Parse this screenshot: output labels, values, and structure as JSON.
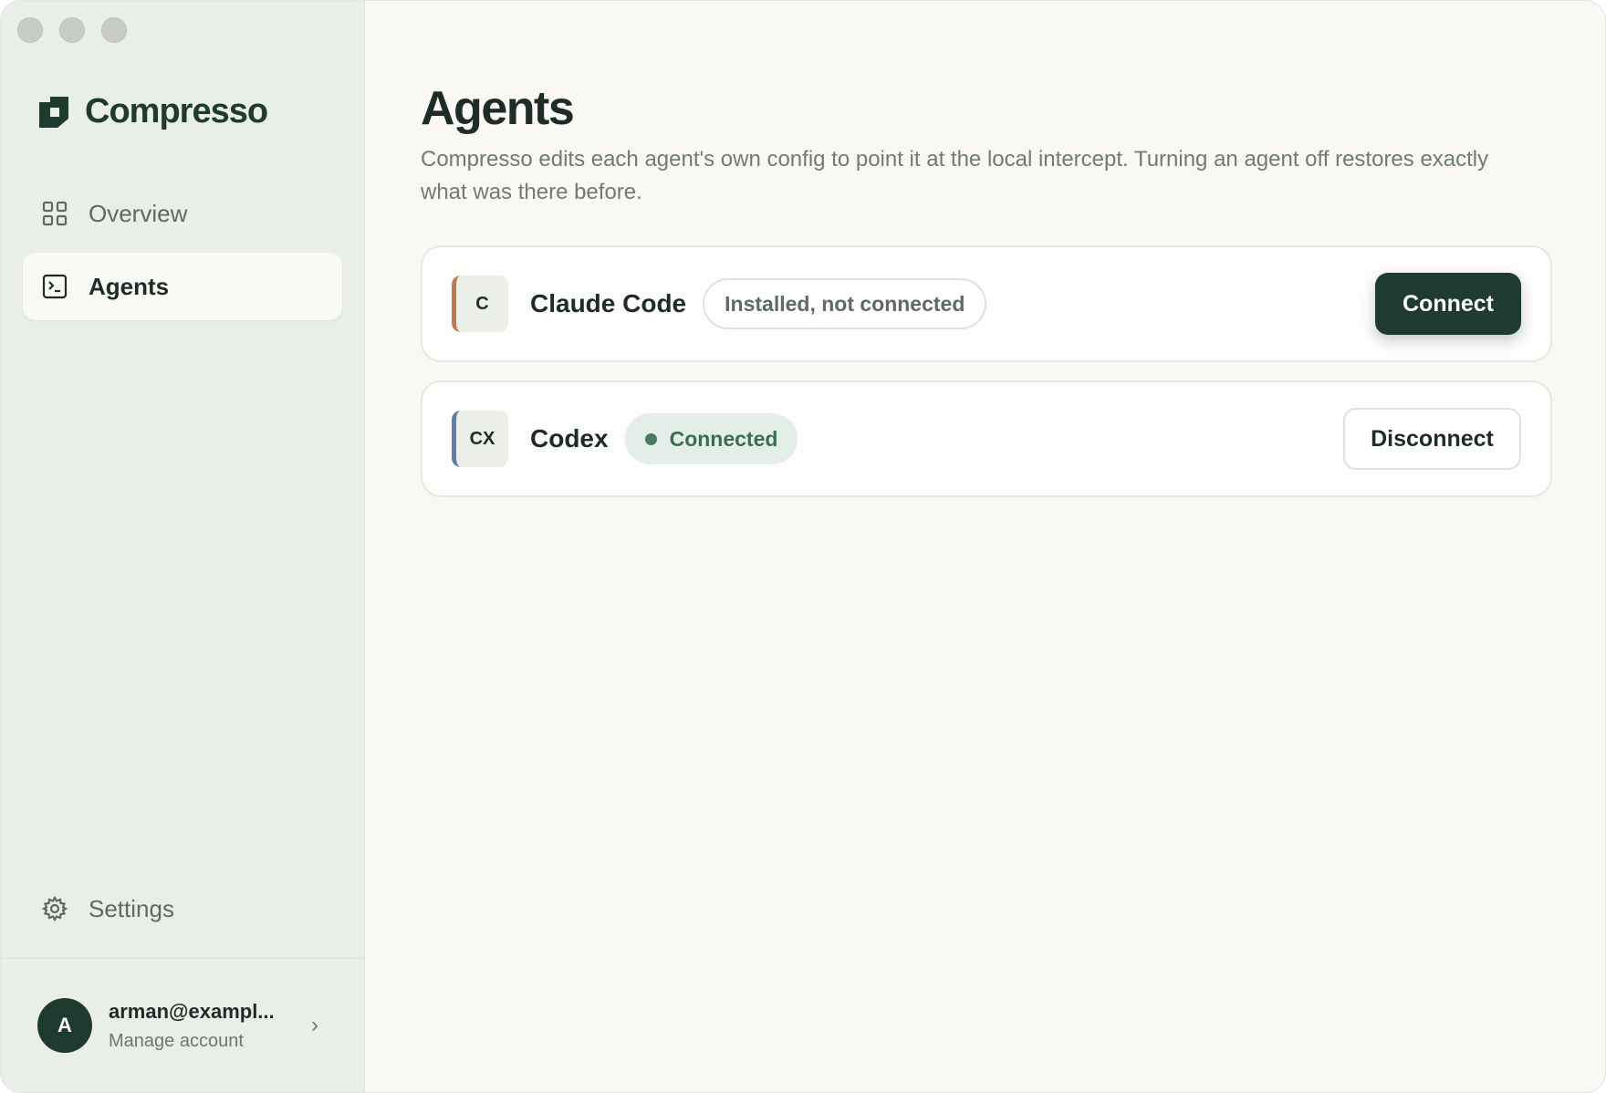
{
  "app": {
    "name": "Compresso"
  },
  "sidebar": {
    "items": [
      {
        "label": "Overview",
        "icon": "grid-icon",
        "active": false
      },
      {
        "label": "Agents",
        "icon": "terminal-icon",
        "active": true
      }
    ],
    "settings_label": "Settings",
    "account": {
      "avatar_letter": "A",
      "email": "arman@exampl...",
      "sub": "Manage account"
    }
  },
  "main": {
    "title": "Agents",
    "description": "Compresso edits each agent's own config to point it at the local intercept. Turning an agent off restores exactly what was there before.",
    "agents": [
      {
        "badge": "C",
        "name": "Claude Code",
        "status": "Installed, not connected",
        "action": "Connect",
        "accent": "#c07a4f"
      },
      {
        "badge": "CX",
        "name": "Codex",
        "status": "Connected",
        "action": "Disconnect",
        "accent": "#5f7ea5"
      }
    ]
  },
  "colors": {
    "brand": "#1f3a2f",
    "sidebar_bg": "#e9eee8",
    "connected_bg": "#e4eee8"
  }
}
